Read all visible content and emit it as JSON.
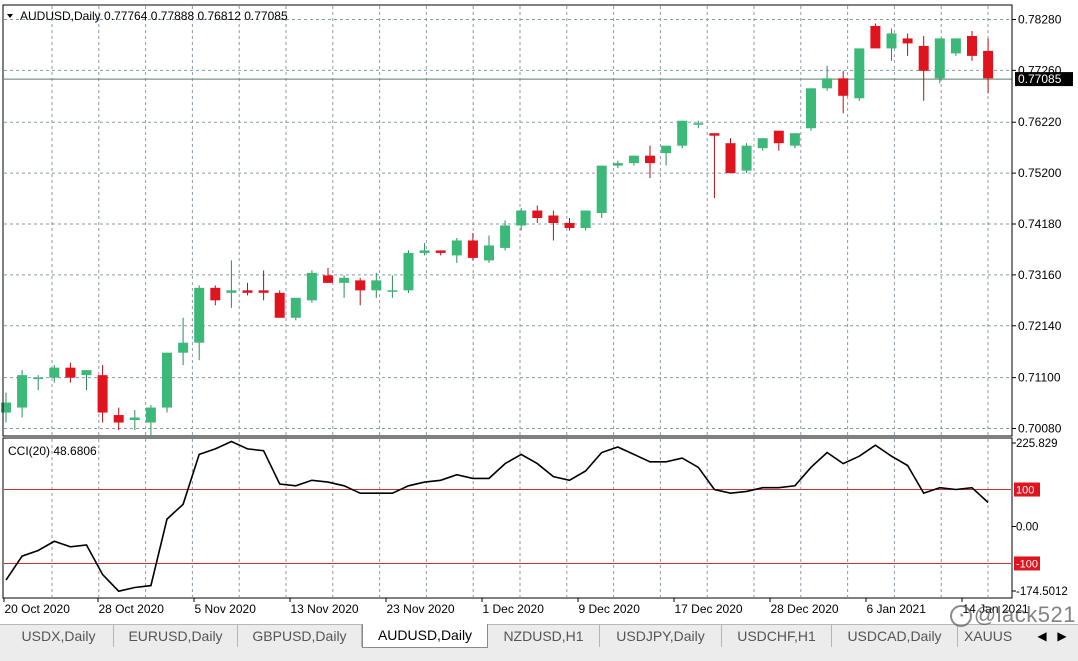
{
  "window": {
    "symbol_header": "AUDUSD,Daily",
    "ohlc": [
      "0.77764",
      "0.77888",
      "0.76812",
      "0.77085"
    ],
    "last_price_label": "0.77085"
  },
  "indicator": {
    "label": "CCI(20) 48.6806"
  },
  "tabs": [
    {
      "label": "USDX,Daily",
      "active": false
    },
    {
      "label": "EURUSD,Daily",
      "active": false
    },
    {
      "label": "GBPUSD,Daily",
      "active": false
    },
    {
      "label": "AUDUSD,Daily",
      "active": true
    },
    {
      "label": "NZDUSD,H1",
      "active": false
    },
    {
      "label": "USDJPY,Daily",
      "active": false
    },
    {
      "label": "USDCHF,H1",
      "active": false
    },
    {
      "label": "USDCAD,Daily",
      "active": false
    },
    {
      "label": "XAUUS",
      "active": false
    }
  ],
  "watermark": "@lack521",
  "colors": {
    "bull": "#3cb878",
    "bear": "#e0141e",
    "grid": "#8a9ba8",
    "level_line": "#c83232",
    "price_tag_bg": "#000000",
    "level_tag_bg": "#e0141e"
  },
  "chart_data": [
    {
      "type": "candlestick",
      "title": "AUDUSD,Daily",
      "x_labels": [
        "20 Oct 2020",
        "28 Oct 2020",
        "5 Nov 2020",
        "13 Nov 2020",
        "23 Nov 2020",
        "1 Dec 2020",
        "9 Dec 2020",
        "17 Dec 2020",
        "28 Dec 2020",
        "6 Jan 2021",
        "14 Jan 2021"
      ],
      "y_ticks": [
        "0.78280",
        "0.77260",
        "0.76220",
        "0.75200",
        "0.74180",
        "0.73160",
        "0.72140",
        "0.71100",
        "0.70080"
      ],
      "ylim": [
        0.6993,
        0.7857
      ],
      "last_price": 0.77085,
      "grid": true,
      "candles": [
        [
          0.704,
          0.708,
          0.702,
          0.706
        ],
        [
          0.705,
          0.7125,
          0.703,
          0.7115
        ],
        [
          0.711,
          0.7115,
          0.7085,
          0.711
        ],
        [
          0.711,
          0.7135,
          0.71,
          0.713
        ],
        [
          0.713,
          0.714,
          0.71,
          0.711
        ],
        [
          0.7115,
          0.7125,
          0.7085,
          0.7125
        ],
        [
          0.7115,
          0.7135,
          0.702,
          0.704
        ],
        [
          0.7035,
          0.705,
          0.7005,
          0.702
        ],
        [
          0.7025,
          0.7045,
          0.7005,
          0.703
        ],
        [
          0.702,
          0.7055,
          0.6995,
          0.705
        ],
        [
          0.705,
          0.716,
          0.704,
          0.716
        ],
        [
          0.716,
          0.723,
          0.7135,
          0.718
        ],
        [
          0.718,
          0.7295,
          0.7145,
          0.729
        ],
        [
          0.729,
          0.7295,
          0.7255,
          0.7265
        ],
        [
          0.728,
          0.7345,
          0.725,
          0.7285
        ],
        [
          0.7285,
          0.73,
          0.7275,
          0.728
        ],
        [
          0.7285,
          0.7325,
          0.7265,
          0.728
        ],
        [
          0.728,
          0.7285,
          0.723,
          0.723
        ],
        [
          0.723,
          0.727,
          0.7225,
          0.727
        ],
        [
          0.7265,
          0.7325,
          0.726,
          0.732
        ],
        [
          0.7315,
          0.733,
          0.73,
          0.73
        ],
        [
          0.73,
          0.7315,
          0.727,
          0.731
        ],
        [
          0.7305,
          0.731,
          0.7255,
          0.7285
        ],
        [
          0.7285,
          0.732,
          0.727,
          0.7305
        ],
        [
          0.7285,
          0.7315,
          0.727,
          0.7285
        ],
        [
          0.7285,
          0.7365,
          0.728,
          0.736
        ],
        [
          0.736,
          0.738,
          0.7355,
          0.7365
        ],
        [
          0.7365,
          0.7365,
          0.7355,
          0.736
        ],
        [
          0.7355,
          0.739,
          0.734,
          0.7385
        ],
        [
          0.7385,
          0.74,
          0.7345,
          0.735
        ],
        [
          0.7345,
          0.7395,
          0.734,
          0.7375
        ],
        [
          0.737,
          0.7425,
          0.7365,
          0.7415
        ],
        [
          0.7415,
          0.745,
          0.7405,
          0.7445
        ],
        [
          0.7445,
          0.7455,
          0.742,
          0.743
        ],
        [
          0.7435,
          0.7445,
          0.7385,
          0.742
        ],
        [
          0.742,
          0.743,
          0.7405,
          0.741
        ],
        [
          0.741,
          0.7445,
          0.7405,
          0.7445
        ],
        [
          0.744,
          0.75,
          0.743,
          0.7535
        ],
        [
          0.7535,
          0.7545,
          0.753,
          0.754
        ],
        [
          0.754,
          0.7555,
          0.7535,
          0.7555
        ],
        [
          0.7555,
          0.7575,
          0.751,
          0.754
        ],
        [
          0.756,
          0.757,
          0.7535,
          0.7575
        ],
        [
          0.7575,
          0.7625,
          0.757,
          0.7625
        ],
        [
          0.762,
          0.7625,
          0.761,
          0.762
        ],
        [
          0.76,
          0.76,
          0.747,
          0.7595
        ],
        [
          0.758,
          0.759,
          0.752,
          0.752
        ],
        [
          0.7525,
          0.758,
          0.752,
          0.7575
        ],
        [
          0.757,
          0.759,
          0.7565,
          0.759
        ],
        [
          0.7605,
          0.7605,
          0.7565,
          0.758
        ],
        [
          0.7575,
          0.76,
          0.757,
          0.76
        ],
        [
          0.761,
          0.769,
          0.7605,
          0.769
        ],
        [
          0.769,
          0.7735,
          0.7685,
          0.771
        ],
        [
          0.771,
          0.7725,
          0.764,
          0.7675
        ],
        [
          0.767,
          0.777,
          0.7665,
          0.777
        ],
        [
          0.7815,
          0.782,
          0.777,
          0.777
        ],
        [
          0.777,
          0.781,
          0.7745,
          0.78
        ],
        [
          0.779,
          0.78,
          0.7755,
          0.778
        ],
        [
          0.7775,
          0.7795,
          0.7665,
          0.7725
        ],
        [
          0.771,
          0.779,
          0.77,
          0.779
        ],
        [
          0.776,
          0.779,
          0.7755,
          0.779
        ],
        [
          0.7795,
          0.7805,
          0.7745,
          0.7755
        ],
        [
          0.7765,
          0.779,
          0.768,
          0.771
        ]
      ]
    },
    {
      "type": "line",
      "title": "CCI(20) 48.6806",
      "y_ticks": [
        "225.829",
        "100",
        "0.00",
        "-100",
        "-174.5012"
      ],
      "ylim": [
        -174.5012,
        225.829
      ],
      "levels": [
        100,
        -100
      ],
      "values": [
        -145,
        -80,
        -65,
        -40,
        -55,
        -50,
        -130,
        -175,
        -165,
        -160,
        20,
        60,
        195,
        210,
        230,
        210,
        205,
        115,
        110,
        125,
        120,
        110,
        90,
        90,
        90,
        110,
        120,
        125,
        140,
        130,
        130,
        170,
        195,
        170,
        135,
        125,
        150,
        200,
        215,
        195,
        175,
        175,
        185,
        160,
        100,
        90,
        95,
        105,
        105,
        110,
        160,
        200,
        170,
        190,
        220,
        190,
        165,
        90,
        105,
        100,
        105,
        65
      ]
    }
  ]
}
